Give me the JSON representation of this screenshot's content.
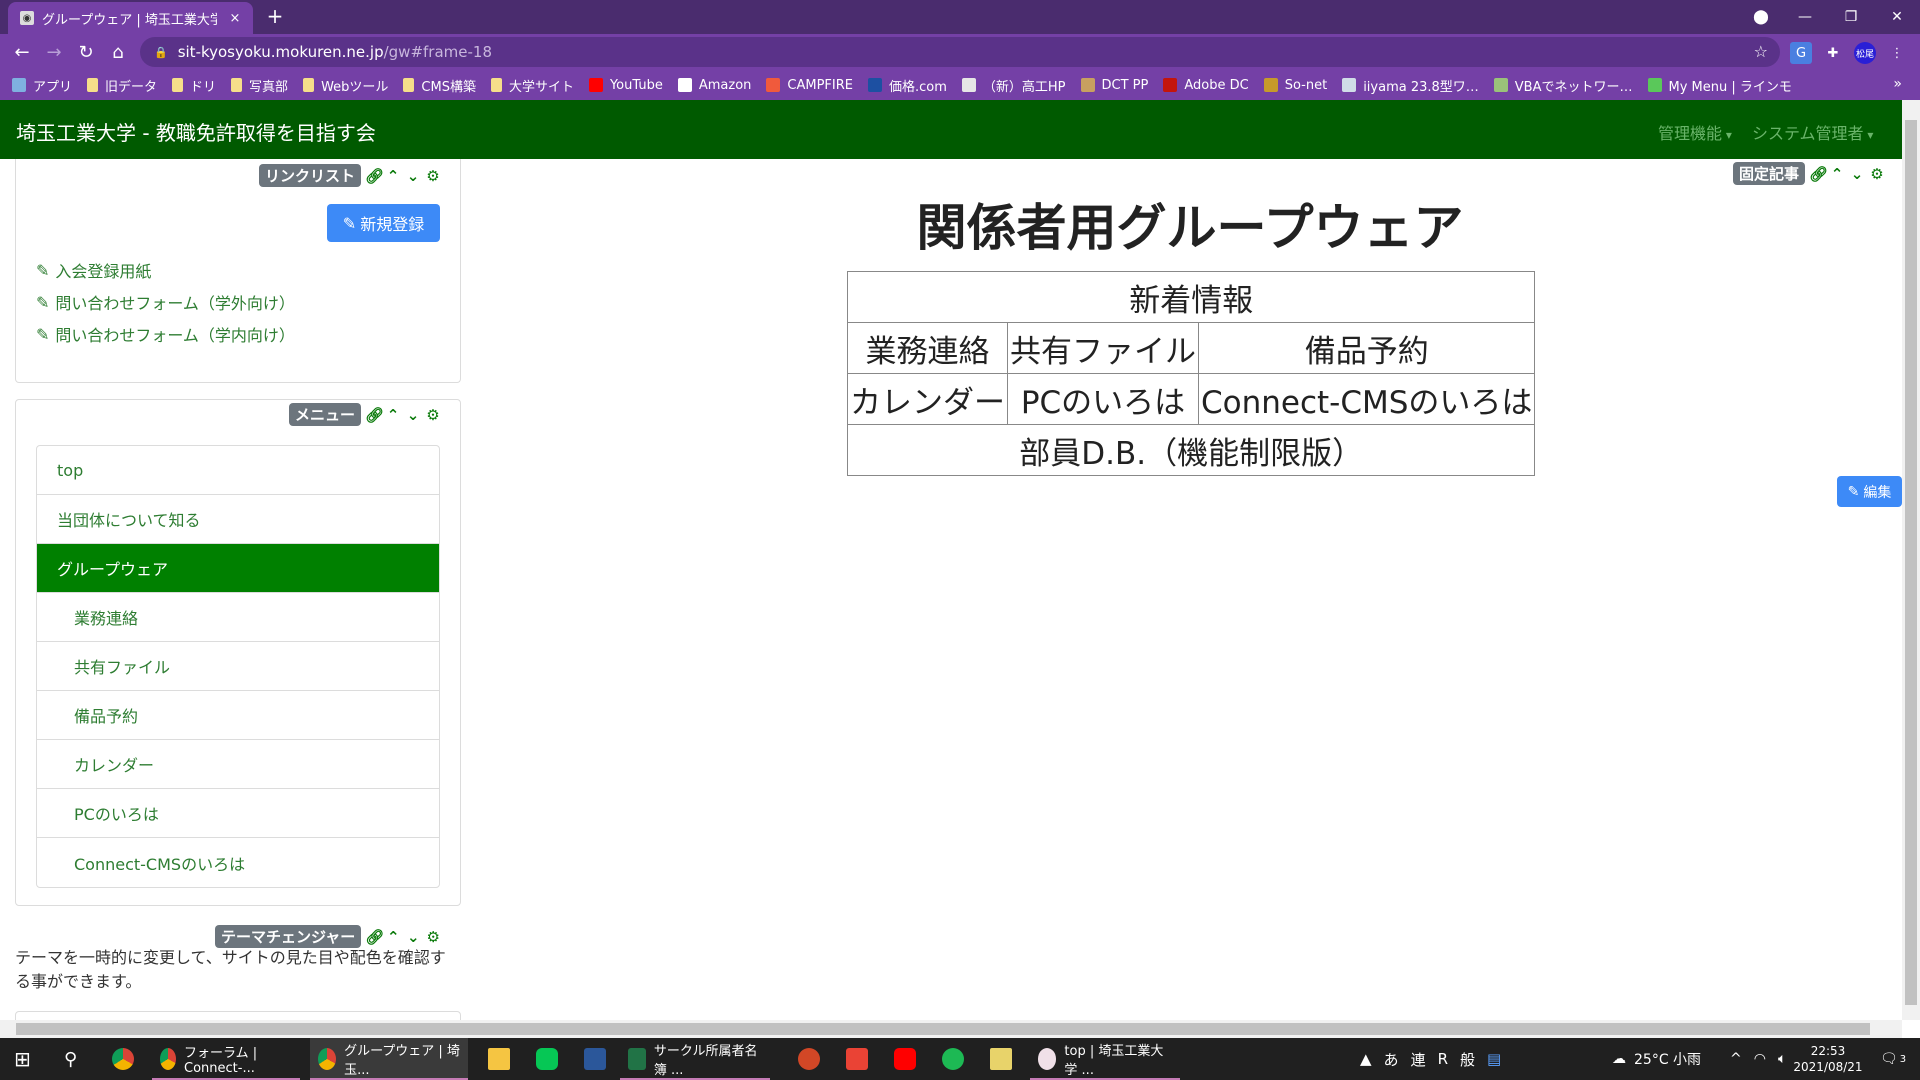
{
  "browser": {
    "tab_title": "グループウェア | 埼玉工業大学",
    "tab_close": "×",
    "new_tab": "+",
    "url_host": "sit-kyosyoku.mokuren.ne.jp",
    "url_path": "/gw#frame-18",
    "profile_initials": "松尾",
    "bookmarks": [
      {
        "label": "アプリ",
        "icon": "apps-grid-icon"
      },
      {
        "label": "旧データ",
        "icon": "folder-icon"
      },
      {
        "label": "ドリ",
        "icon": "folder-icon"
      },
      {
        "label": "写真部",
        "icon": "folder-icon"
      },
      {
        "label": "Webツール",
        "icon": "folder-icon"
      },
      {
        "label": "CMS構築",
        "icon": "folder-icon"
      },
      {
        "label": "大学サイト",
        "icon": "folder-icon"
      },
      {
        "label": "YouTube",
        "icon": "youtube-icon"
      },
      {
        "label": "Amazon",
        "icon": "amazon-icon"
      },
      {
        "label": "CAMPFIRE",
        "icon": "campfire-icon"
      },
      {
        "label": "価格.com",
        "icon": "kakaku-icon"
      },
      {
        "label": "（新）高工HP",
        "icon": "page-icon"
      },
      {
        "label": "DCT PP",
        "icon": "dct-icon"
      },
      {
        "label": "Adobe DC",
        "icon": "adobe-icon"
      },
      {
        "label": "So-net",
        "icon": "sonet-icon"
      },
      {
        "label": "iiyama 23.8型ワ…",
        "icon": "x-icon"
      },
      {
        "label": "VBAでネットワー…",
        "icon": "vba-icon"
      },
      {
        "label": "My Menu | ラインモ",
        "icon": "linemo-icon"
      }
    ],
    "bookmarks_more": "»"
  },
  "site": {
    "brand": "埼玉工業大学 - 教職免許取得を目指す会",
    "nav_right": [
      "管理機能",
      "システム管理者"
    ]
  },
  "left": {
    "linklist": {
      "label": "リンクリスト",
      "new_button": "新規登録",
      "links": [
        "入会登録用紙",
        "問い合わせフォーム（学外向け）",
        "問い合わせフォーム（学内向け）"
      ]
    },
    "menu": {
      "label": "メニュー",
      "items": [
        {
          "label": "top",
          "level": 0,
          "active": false
        },
        {
          "label": "当団体について知る",
          "level": 0,
          "active": false
        },
        {
          "label": "グループウェア",
          "level": 0,
          "active": true
        },
        {
          "label": "業務連絡",
          "level": 1,
          "active": false
        },
        {
          "label": "共有ファイル",
          "level": 1,
          "active": false
        },
        {
          "label": "備品予約",
          "level": 1,
          "active": false
        },
        {
          "label": "カレンダー",
          "level": 1,
          "active": false
        },
        {
          "label": "PCのいろは",
          "level": 1,
          "active": false
        },
        {
          "label": "Connect-CMSのいろは",
          "level": 1,
          "active": false
        }
      ]
    },
    "theme_changer": {
      "label": "テーマチェンジャー",
      "description": "テーマを一時的に変更して、サイトの見た目や配色を確認する事ができます。"
    }
  },
  "main": {
    "frame_label": "固定記事",
    "title": "関係者用グループウェア",
    "table": {
      "header": "新着情報",
      "row1": [
        "業務連絡",
        "共有ファイル",
        "備品予約"
      ],
      "row2": [
        "カレンダー",
        "PCのいろは",
        "Connect-CMSのいろは"
      ],
      "footer": "部員D.B.（機能制限版）"
    },
    "edit_button": "編集"
  },
  "taskbar": {
    "windows": [
      {
        "label": "フォーラム | Connect-...",
        "active": false
      },
      {
        "label": "グループウェア | 埼玉...",
        "active": true
      },
      {
        "label": "サークル所属者名簿 ...",
        "active": false
      },
      {
        "label": "top | 埼玉工業大学 ...",
        "active": false
      }
    ],
    "ime": [
      "あ",
      "連",
      "R",
      "般"
    ],
    "weather": "25°C 小雨",
    "time": "22:53",
    "date": "2021/08/21",
    "notifications": "3"
  },
  "colors": {
    "browser_frame": "#7440a6",
    "navbar": "#005a00",
    "menu_active": "#008000",
    "link_green": "#2e7d32",
    "primary_button": "#3d8af7",
    "frame_label_bg": "#6c757d"
  }
}
